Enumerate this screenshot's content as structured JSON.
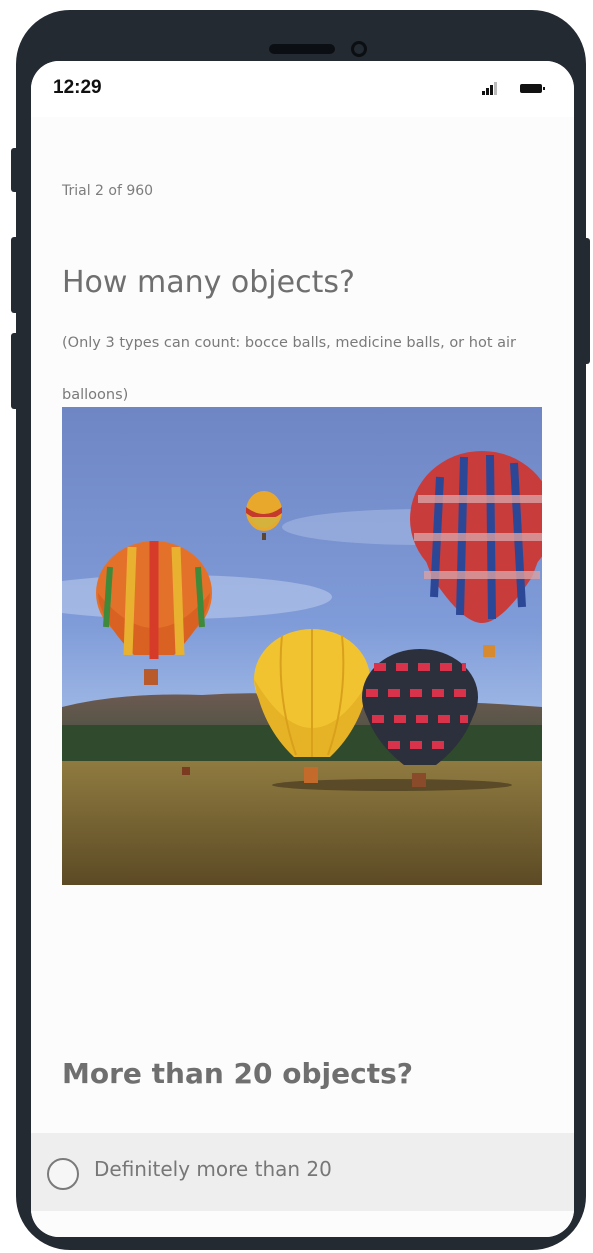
{
  "status_bar": {
    "time": "12:29",
    "signal_icon": "cellular-signal-icon",
    "battery_icon": "battery-full-icon"
  },
  "survey": {
    "trial_counter": "Trial 2 of 960",
    "question": "How many objects?",
    "instructions": "(Only 3 types can count: bocce balls, medicine balls, or hot air balloons)",
    "question2": "More than 20 objects?",
    "options": [
      {
        "label": "Definitely more than 20",
        "selected": false
      }
    ]
  },
  "colors": {
    "frame": "#232a32",
    "screen_bg": "#fcfcfd",
    "option_bg": "#eeeeee",
    "text_muted": "#6f6f6f"
  }
}
